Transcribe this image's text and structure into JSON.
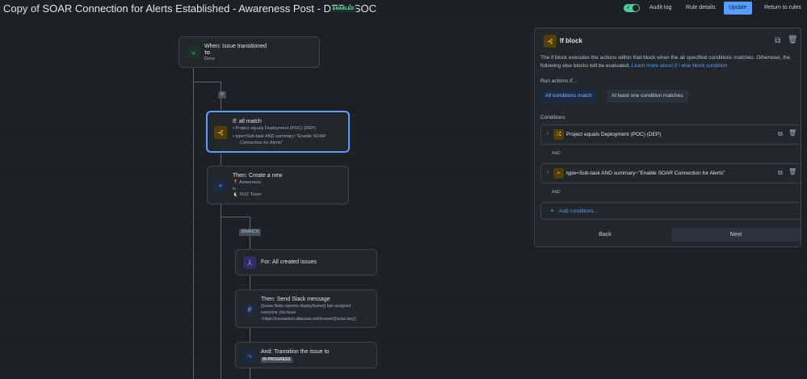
{
  "header": {
    "title": "Copy of SOAR Connection for Alerts Established - Awareness Post - DEP / SOC",
    "status_badge": "ENABLED",
    "audit_log": "Audit log",
    "rule_details": "Rule details",
    "update": "Update",
    "return": "Return to rules"
  },
  "flow": {
    "trigger": {
      "title": "When: Issue transitioned",
      "to_label": "TO",
      "to_value": "Done"
    },
    "if_tag": "IF",
    "if_card": {
      "title": "If: all match",
      "cond1": "Project equals Deployment (POC) (DEP)",
      "cond2_line1": "type=Sub-task AND summary~\"Enable SOAR",
      "cond2_line2": "Connection for Alerts\""
    },
    "create_card": {
      "title": "Then: Create a new",
      "type": "Awareness",
      "in_label": "in",
      "project": "SOC Team"
    },
    "branch_tag": "BRANCH",
    "for_card": {
      "title": "For: All created issues"
    },
    "slack_card": {
      "title": "Then: Send Slack message",
      "line1": "{{issue.fields.reporter.displayName}} has assigned",
      "line2": "everyone Jira Issue",
      "line3": "<https://novawatch.atlassian.net/browse/{{issue.key}}"
    },
    "transition_card": {
      "title": "And: Transition the issue to",
      "status": "IN PROGRESS"
    }
  },
  "panel": {
    "title": "If block",
    "description_text": "The if block executes the actions within that block when the all specified conditions matches. Otherwise, the following else blocks will be evaluated.",
    "learn_more": "Learn more about if / else block condition",
    "run_actions_label": "Run actions if...",
    "option_all": "All conditions match",
    "option_any": "At least one condition matches",
    "conditions_label": "Conditions",
    "conditions": [
      {
        "text": "Project equals Deployment (POC) (DEP)",
        "icon": "shuffle-icon"
      },
      {
        "text": "type=Sub-task AND summary~\"Enable SOAR Connection for Alerts\"",
        "icon": "search-icon"
      }
    ],
    "and_label": "AND",
    "add_conditions": "Add conditions...",
    "back": "Back",
    "next": "Next"
  },
  "colors": {
    "background": "#1d2125",
    "accent": "#579dff",
    "enabled_green": "#4bce97",
    "if_yellow": "#f5cd47"
  }
}
